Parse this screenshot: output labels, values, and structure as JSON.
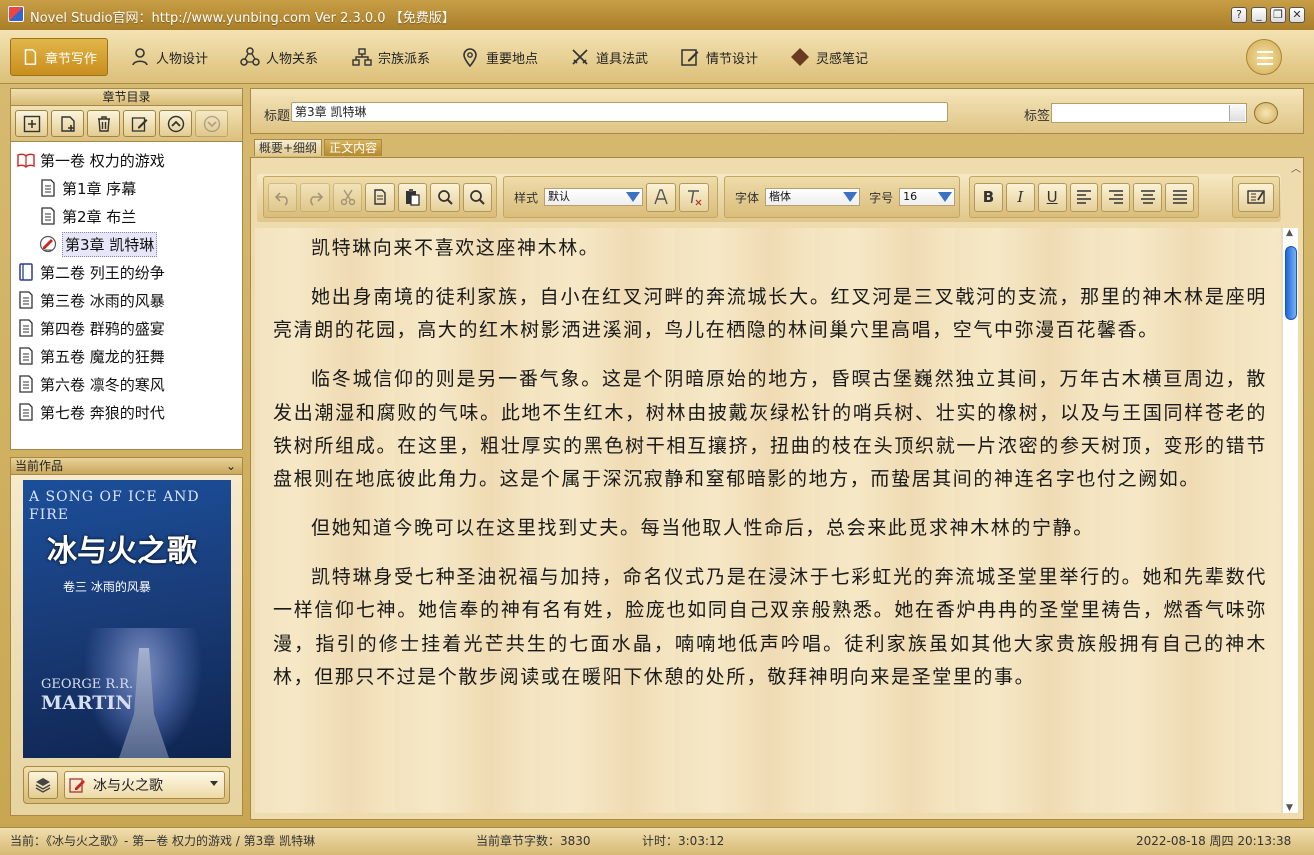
{
  "window": {
    "title": "Novel Studio官网：http://www.yunbing.com Ver 2.3.0.0 【免费版】"
  },
  "toolbar": [
    {
      "label": "章节写作",
      "icon": "document-icon",
      "active": true
    },
    {
      "label": "人物设计",
      "icon": "person-icon"
    },
    {
      "label": "人物关系",
      "icon": "people-relation-icon"
    },
    {
      "label": "宗族派系",
      "icon": "hierarchy-icon"
    },
    {
      "label": "重要地点",
      "icon": "location-pin-icon"
    },
    {
      "label": "道具法武",
      "icon": "crossed-swords-icon"
    },
    {
      "label": "情节设计",
      "icon": "edit-icon"
    },
    {
      "label": "灵感笔记",
      "icon": "diamond-icon"
    }
  ],
  "left": {
    "chapter_dir_title": "章节目录",
    "tree": [
      {
        "label": "第一卷  权力的游戏",
        "level": 0,
        "icon": "open-book-icon"
      },
      {
        "label": "第1章  序幕",
        "level": 1,
        "icon": "page-icon"
      },
      {
        "label": "第2章  布兰",
        "level": 1,
        "icon": "page-icon"
      },
      {
        "label": "第3章  凯特琳",
        "level": 1,
        "icon": "writing-icon",
        "selected": true
      },
      {
        "label": "第二卷  列王的纷争",
        "level": 0,
        "icon": "closed-book-icon"
      },
      {
        "label": "第三卷  冰雨的风暴",
        "level": 0,
        "icon": "page-icon"
      },
      {
        "label": "第四卷  群鸦的盛宴",
        "level": 0,
        "icon": "page-icon"
      },
      {
        "label": "第五卷  魔龙的狂舞",
        "level": 0,
        "icon": "page-icon"
      },
      {
        "label": "第六卷  凛冬的寒风",
        "level": 0,
        "icon": "page-icon"
      },
      {
        "label": "第七卷  奔狼的时代",
        "level": 0,
        "icon": "page-icon"
      }
    ],
    "current_work_title": "当前作品",
    "cover": {
      "line1": "A SONG OF ICE AND FIRE",
      "line2": "冰与火之歌",
      "line3": "卷三 冰雨的风暴",
      "line4a": "GEORGE R.R.",
      "line4b": "MARTIN"
    },
    "work_name": "冰与火之歌"
  },
  "editor": {
    "title_label": "标题",
    "title_value": "第3章 凯特琳",
    "tag_label": "标签",
    "tabs": [
      "概要+细纲",
      "正文内容"
    ],
    "style_label": "样式",
    "style_value": "默认",
    "font_label": "字体",
    "font_value": "楷体",
    "size_label": "字号",
    "size_value": "16",
    "paragraphs": [
      "凯特琳向来不喜欢这座神木林。",
      "她出身南境的徒利家族，自小在红叉河畔的奔流城长大。红叉河是三叉戟河的支流，那里的神木林是座明亮清朗的花园，高大的红木树影洒进溪涧，鸟儿在栖隐的林间巢穴里高唱，空气中弥漫百花馨香。",
      "临冬城信仰的则是另一番气象。这是个阴暗原始的地方，昏暝古堡巍然独立其间，万年古木横亘周边，散发出潮湿和腐败的气味。此地不生红木，树林由披戴灰绿松针的哨兵树、壮实的橡树，以及与王国同样苍老的铁树所组成。在这里，粗壮厚实的黑色树干相互攘挤，扭曲的枝在头顶织就一片浓密的参天树顶，变形的错节盘根则在地底彼此角力。这是个属于深沉寂静和窒郁暗影的地方，而蛰居其间的神连名字也付之阙如。",
      "但她知道今晚可以在这里找到丈夫。每当他取人性命后，总会来此觅求神木林的宁静。",
      "凯特琳身受七种圣油祝福与加持，命名仪式乃是在浸沐于七彩虹光的奔流城圣堂里举行的。她和先辈数代一样信仰七神。她信奉的神有名有姓，脸庞也如同自己双亲般熟悉。她在香炉冉冉的圣堂里祷告，燃香气味弥漫，指引的修士挂着光芒共生的七面水晶，喃喃地低声吟唱。徒利家族虽如其他大家贵族般拥有自己的神木林，但那只不过是个散步阅读或在暖阳下休憩的处所，敬拜神明向来是圣堂里的事。"
    ]
  },
  "status": {
    "current": "当前：《冰与火之歌》- 第一卷 权力的游戏 / 第3章 凯特琳",
    "word_count": "当前章节字数：3830",
    "timer": "计时：3:03:12",
    "datetime": "2022-08-18 周四 20:13:38"
  }
}
